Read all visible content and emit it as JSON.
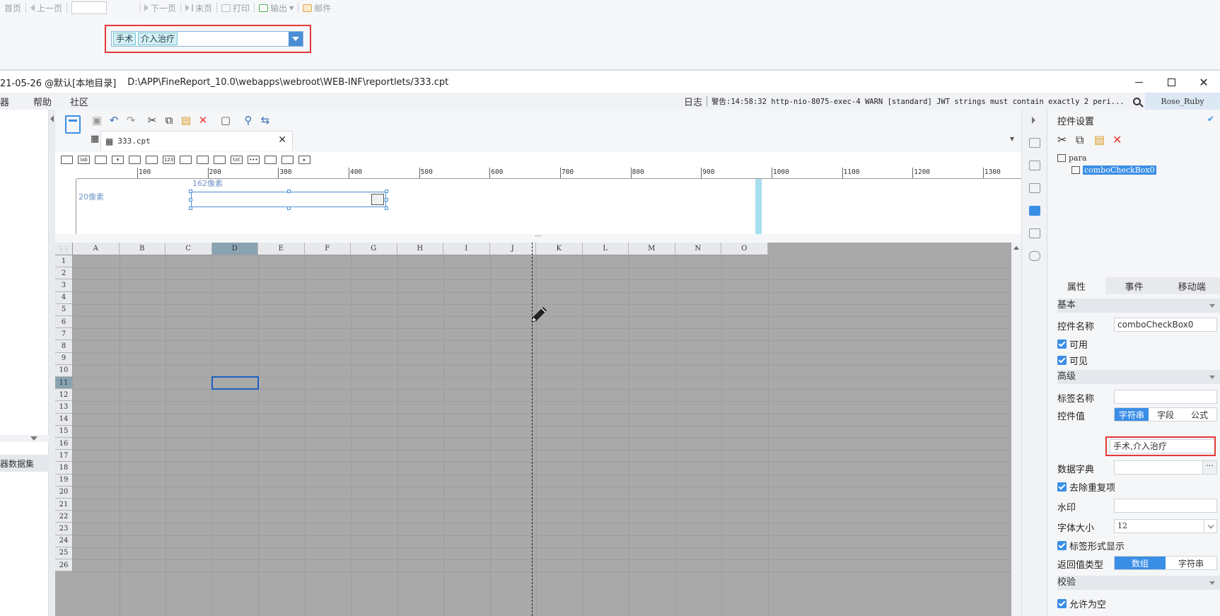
{
  "preview": {
    "toolbar": {
      "first_page": "首页",
      "prev_page": "上一页",
      "next_page": "下一页",
      "last_page": "末页",
      "print": "打印",
      "export": "输出",
      "email": "邮件"
    },
    "combo_tags": [
      "手术",
      "介入治疗"
    ]
  },
  "designer": {
    "title_prefix": "21-05-26 @默认[本地目录]",
    "title_path": "D:\\APP\\FineReport_10.0\\webapps\\webroot\\WEB-INF\\reportlets/333.cpt",
    "menu": [
      "器",
      "帮助",
      "社区"
    ],
    "log_label": "日志",
    "log_text": "警告:14:58:32 http-nio-8075-exec-4 WARN [standard] JWT strings must contain exactly 2 peri...",
    "user": "Rose_Ruby",
    "left_dataset_label": "器数据集",
    "tab_file": "333.cpt",
    "ruler_labels": [
      "100",
      "200",
      "300",
      "400",
      "500",
      "600",
      "700",
      "800",
      "900",
      "1000",
      "1100",
      "1200",
      "1300"
    ],
    "param_pane": {
      "left_px_label": "20像素",
      "top_px_label": "162像素"
    },
    "grid": {
      "columns": [
        "A",
        "B",
        "C",
        "D",
        "E",
        "F",
        "G",
        "H",
        "I",
        "J",
        "K",
        "L",
        "M",
        "N",
        "O"
      ],
      "rows": [
        "1",
        "2",
        "3",
        "4",
        "5",
        "6",
        "7",
        "8",
        "9",
        "10",
        "11",
        "12",
        "13",
        "14",
        "15",
        "16",
        "17",
        "18",
        "19",
        "20",
        "21",
        "22",
        "23",
        "24",
        "25",
        "26"
      ],
      "selected_column": "D",
      "selected_row": "11"
    }
  },
  "props": {
    "title": "控件设置",
    "tree_root": "para",
    "tree_child": "comboCheckBox0",
    "tabs": [
      "属性",
      "事件",
      "移动端"
    ],
    "section_basic": "基本",
    "widget_name_label": "控件名称",
    "widget_name_value": "comboCheckBox0",
    "enabled_label": "可用",
    "visible_label": "可见",
    "section_advanced": "高级",
    "tag_name_label": "标签名称",
    "widget_value_label": "控件值",
    "value_type_options": [
      "字符串",
      "字段",
      "公式"
    ],
    "widget_value": "手术,介入治疗",
    "data_dict_label": "数据字典",
    "dict_btn": "···",
    "remove_dup_label": "去除重复项",
    "watermark_label": "水印",
    "font_size_label": "字体大小",
    "font_size_value": "12",
    "tag_display_label": "标签形式显示",
    "return_type_label": "返回值类型",
    "return_type_options": [
      "数组",
      "字符串"
    ],
    "section_validate": "校验",
    "allow_empty_label": "允许为空"
  }
}
